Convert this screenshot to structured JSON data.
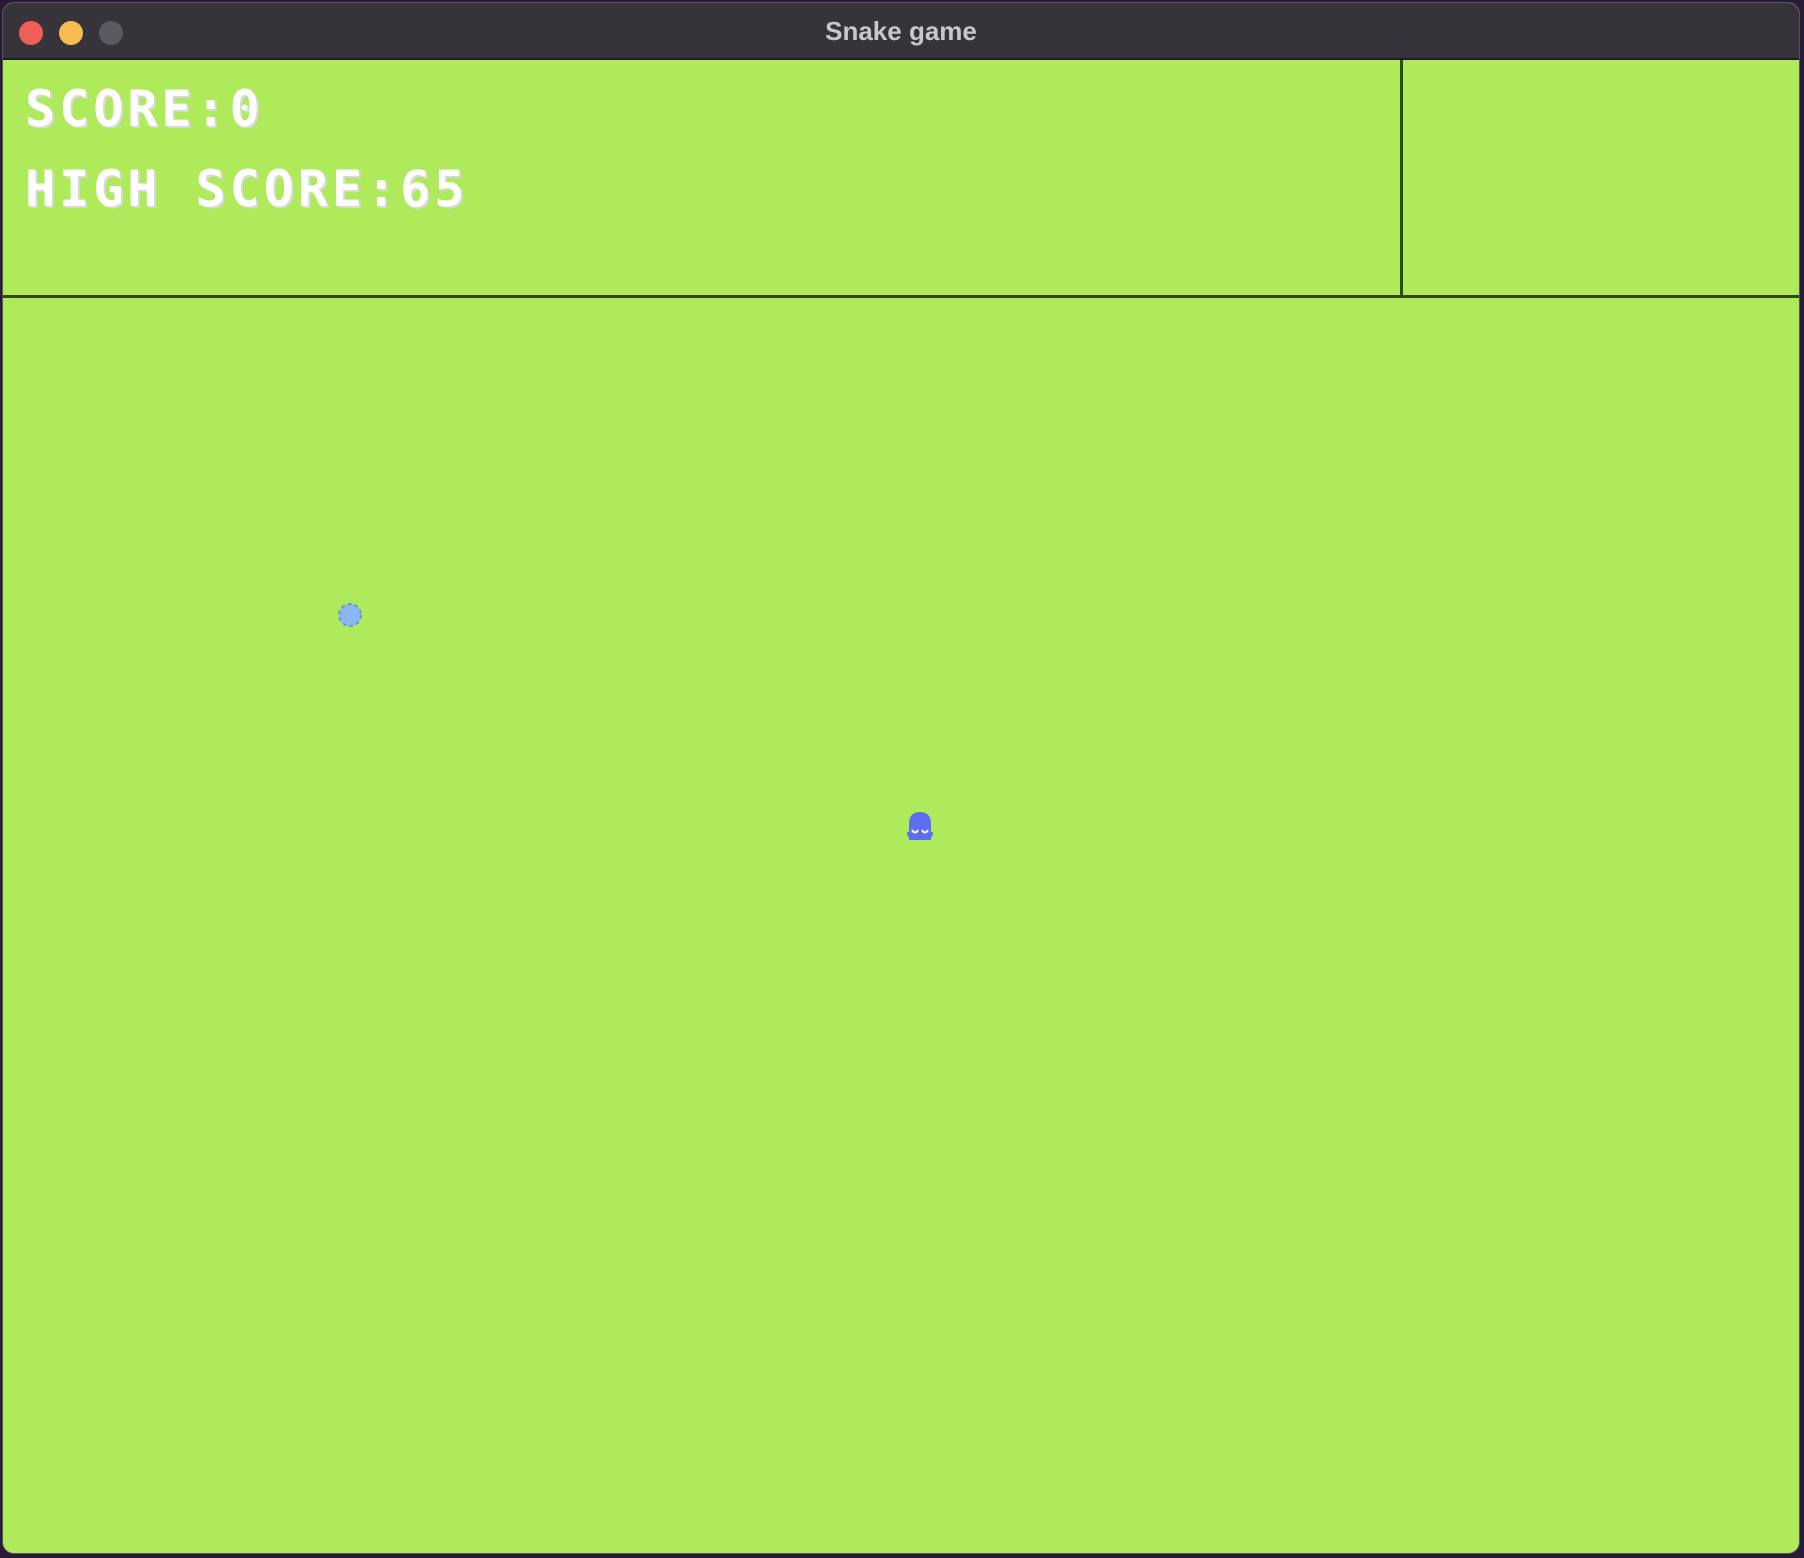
{
  "window": {
    "title": "Snake game",
    "controls": [
      "close",
      "minimize",
      "zoom"
    ]
  },
  "hud": {
    "score_label": "SCORE:",
    "score_value": "0",
    "high_score_label": "HIGH SCORE:",
    "high_score_value": "65"
  },
  "colors": {
    "playfield": "#aeea5a",
    "grid_line": "#2f4a1c",
    "hud_text": "#ffffff",
    "food": "#8ab6f2",
    "snake": "#5d6ef0",
    "titlebar": "#36333b"
  },
  "sprites": {
    "food_icon": "food-pellet-icon",
    "snake_icon": "snake-head-icon"
  }
}
